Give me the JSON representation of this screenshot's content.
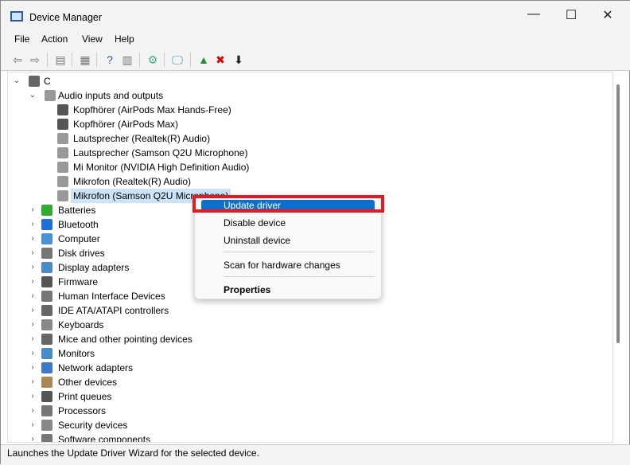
{
  "window": {
    "title": "Device Manager",
    "controls": [
      "—",
      "☐",
      "✕"
    ]
  },
  "menubar": [
    "File",
    "Action",
    "View",
    "Help"
  ],
  "toolbar": [
    {
      "icon": "back-arrow-icon",
      "g": "⇦",
      "c": "#777"
    },
    {
      "icon": "forward-arrow-icon",
      "g": "⇨",
      "c": "#777"
    },
    {
      "icon": "show-hide-console-tree-icon",
      "g": "▤",
      "c": "#777"
    },
    {
      "icon": "properties-icon",
      "g": "▦",
      "c": "#777"
    },
    {
      "icon": "help-icon",
      "g": "?",
      "c": "#2a52be"
    },
    {
      "icon": "action-pane-icon",
      "g": "▥",
      "c": "#777"
    },
    {
      "icon": "update-driver-icon",
      "g": "⚙",
      "c": "#4a8"
    },
    {
      "icon": "scan-hardware-icon",
      "g": "🖵",
      "c": "#3a8ac8"
    },
    {
      "icon": "enable-device-icon",
      "g": "▲",
      "c": "#2a8a3a"
    },
    {
      "icon": "uninstall-icon",
      "g": "✖",
      "c": "#d00"
    },
    {
      "icon": "download-icon",
      "g": "⬇",
      "c": "#222"
    }
  ],
  "tree": {
    "root": "C",
    "audio": {
      "label": "Audio inputs and outputs",
      "children": [
        "Kopfhörer (AirPods Max Hands-Free)",
        "Kopfhörer (AirPods Max)",
        "Lautsprecher (Realtek(R) Audio)",
        "Lautsprecher (Samson Q2U Microphone)",
        "Mi Monitor (NVIDIA High Definition Audio)",
        "Mikrofon (Realtek(R) Audio)",
        "Mikrofon (Samson Q2U Microphone)"
      ]
    },
    "categories": [
      "Batteries",
      "Bluetooth",
      "Computer",
      "Disk drives",
      "Display adapters",
      "Firmware",
      "Human Interface Devices",
      "IDE ATA/ATAPI controllers",
      "Keyboards",
      "Mice and other pointing devices",
      "Monitors",
      "Network adapters",
      "Other devices",
      "Print queues",
      "Processors",
      "Security devices",
      "Software components"
    ]
  },
  "context_menu": {
    "items": [
      "Update driver",
      "Disable device",
      "Uninstall device",
      "Scan for hardware changes",
      "Properties"
    ],
    "highlighted": "Update driver"
  },
  "status": "Launches the Update Driver Wizard for the selected device.",
  "colors": {
    "highlight": "#0a6fcf",
    "annotation": "#e01b24",
    "selection": "#cce4f7"
  }
}
